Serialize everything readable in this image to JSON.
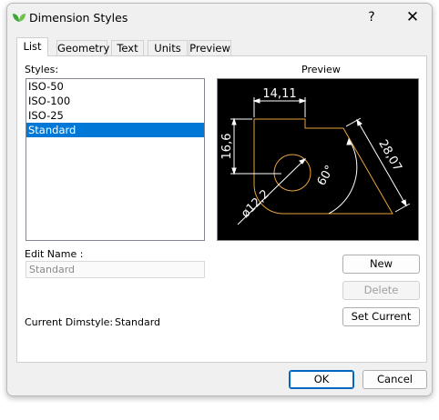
{
  "window": {
    "title": "Dimension Styles",
    "help_label": "?",
    "close_label": "✕"
  },
  "tabs": [
    "List",
    "Geometry",
    "Text",
    "Units",
    "Preview"
  ],
  "list_tab": {
    "styles_label": "Styles:",
    "styles": [
      "ISO-50",
      "ISO-100",
      "ISO-25",
      "Standard"
    ],
    "selected_style": "Standard",
    "preview_label": "Preview",
    "edit_name_label": "Edit Name :",
    "edit_name_value": "Standard",
    "current_dimstyle_label": "Current Dimstyle:",
    "current_dimstyle_value": "Standard",
    "new_button": "New",
    "delete_button": "Delete",
    "set_current_button": "Set Current"
  },
  "preview": {
    "dim_top": "14,11",
    "dim_left": "16,6",
    "dim_diag": "28,07",
    "dim_angle": "60°",
    "dim_diameter": "ø12,2",
    "colors": {
      "geometry": "#e8a33a",
      "dimension": "#ffffff",
      "background": "#000000"
    }
  },
  "footer": {
    "ok_label": "OK",
    "cancel_label": "Cancel"
  },
  "colors": {
    "accent": "#0078d7",
    "app_icon": "#3fa535"
  }
}
